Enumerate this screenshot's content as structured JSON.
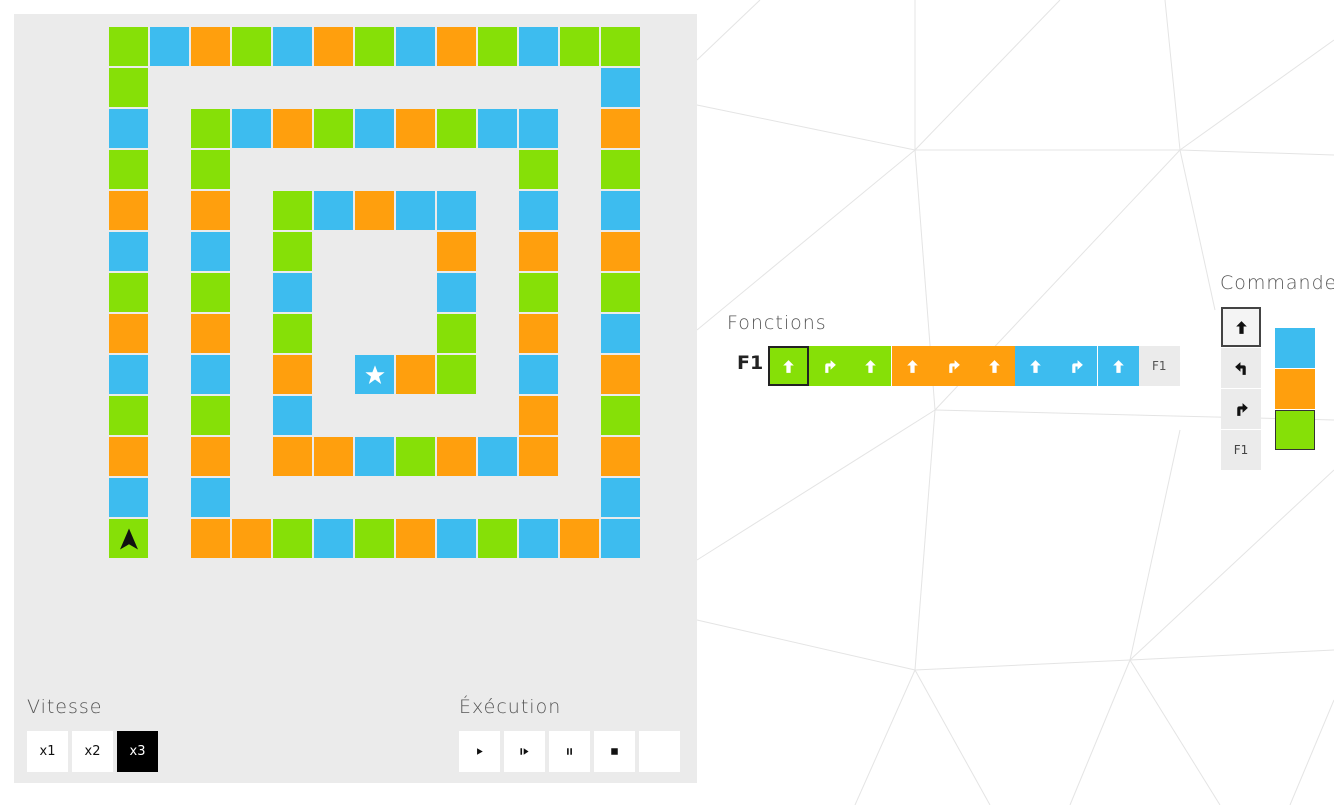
{
  "colors": {
    "blue": "#3dbcef",
    "orange": "#ff9f0d",
    "green": "#86e007"
  },
  "board": {
    "rows": [
      "..GBOGBOGBOGBGG",
      "..G...........B",
      "..B.GBOGBOGBB.O",
      "..G.G.......G.G",
      "..O.O.GBOBB.B.B",
      "..B.B.G...O.O.O",
      "..G.G.B...B.G.G",
      "..O.O.G...G.O.B",
      "..B.B.O.BOG.B.O",
      "..G.G.B.....O.G",
      "..O.O.OOBGOBO.O",
      "..B.B.........B",
      "..G.OOGBGOBGBOB"
    ],
    "robot": {
      "row": 12,
      "col": 2,
      "facing": "up",
      "icon": "robot-arrow-icon"
    },
    "goal": {
      "row": 8,
      "col": 8,
      "icon": "star-icon"
    }
  },
  "speed": {
    "label": "Vitesse",
    "options": [
      "x1",
      "x2",
      "x3"
    ],
    "selected": "x3"
  },
  "execution": {
    "label": "Éxécution",
    "buttons": [
      {
        "name": "play",
        "icon": "play-icon"
      },
      {
        "name": "step",
        "icon": "step-icon"
      },
      {
        "name": "pause",
        "icon": "pause-icon"
      },
      {
        "name": "stop",
        "icon": "stop-icon"
      },
      {
        "name": "clear",
        "icon": "close-icon"
      }
    ]
  },
  "functions": {
    "label": "Fonctions",
    "f1": {
      "label": "F1",
      "slots": [
        {
          "color": "green",
          "command": "forward",
          "selected": true
        },
        {
          "color": "green",
          "command": "right"
        },
        {
          "color": "green",
          "command": "forward"
        },
        {
          "color": "orange",
          "command": "forward"
        },
        {
          "color": "orange",
          "command": "right"
        },
        {
          "color": "orange",
          "command": "forward"
        },
        {
          "color": "blue",
          "command": "forward"
        },
        {
          "color": "blue",
          "command": "right"
        },
        {
          "color": "blue",
          "command": "forward"
        },
        {
          "color": "empty",
          "command": "call",
          "text": "F1"
        }
      ]
    }
  },
  "commands": {
    "label": "Commandes",
    "items": [
      {
        "name": "forward",
        "icon": "arrow-up-icon",
        "selected": true
      },
      {
        "name": "left",
        "icon": "turn-left-icon"
      },
      {
        "name": "right",
        "icon": "turn-right-icon"
      },
      {
        "name": "call-f1",
        "text": "F1"
      }
    ],
    "colors": [
      {
        "name": "blue"
      },
      {
        "name": "orange"
      },
      {
        "name": "green",
        "selected": true
      }
    ]
  }
}
